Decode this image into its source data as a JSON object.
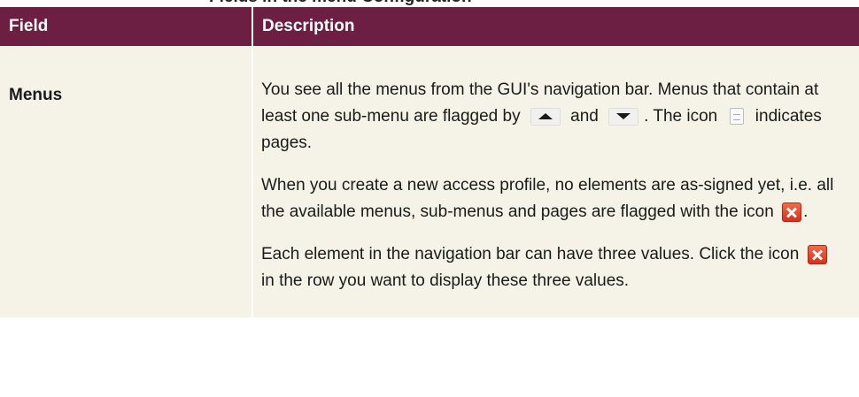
{
  "page": {
    "clipped_heading": "Fields in the menu Configuration"
  },
  "table": {
    "headers": {
      "field": "Field",
      "description": "Description"
    },
    "row": {
      "field": "Menus",
      "p1": {
        "a": "You see all the menus from the GUI's navigation bar. Menus that contain at least one sub-menu are flagged by",
        "b": "and",
        "c": ". The icon",
        "d": "indicates pages."
      },
      "p2": {
        "a": "When you create a new access profile, no elements are as-signed yet, i.e. all the available menus, sub-menus and pages are flagged with the icon",
        "b": "."
      },
      "p3": {
        "a": "Each element in the navigation bar can have three values. Click the icon",
        "b": "in the row you want to display these three values."
      }
    }
  },
  "icons": {
    "expand": "arrow-up-icon",
    "collapse": "arrow-down-icon",
    "page": "page-icon",
    "not_assigned": "red-x-icon"
  },
  "colors": {
    "header_background": "#6d1e43",
    "row_background": "#f5f3e8",
    "not_assigned_icon": "#d92f1a"
  }
}
